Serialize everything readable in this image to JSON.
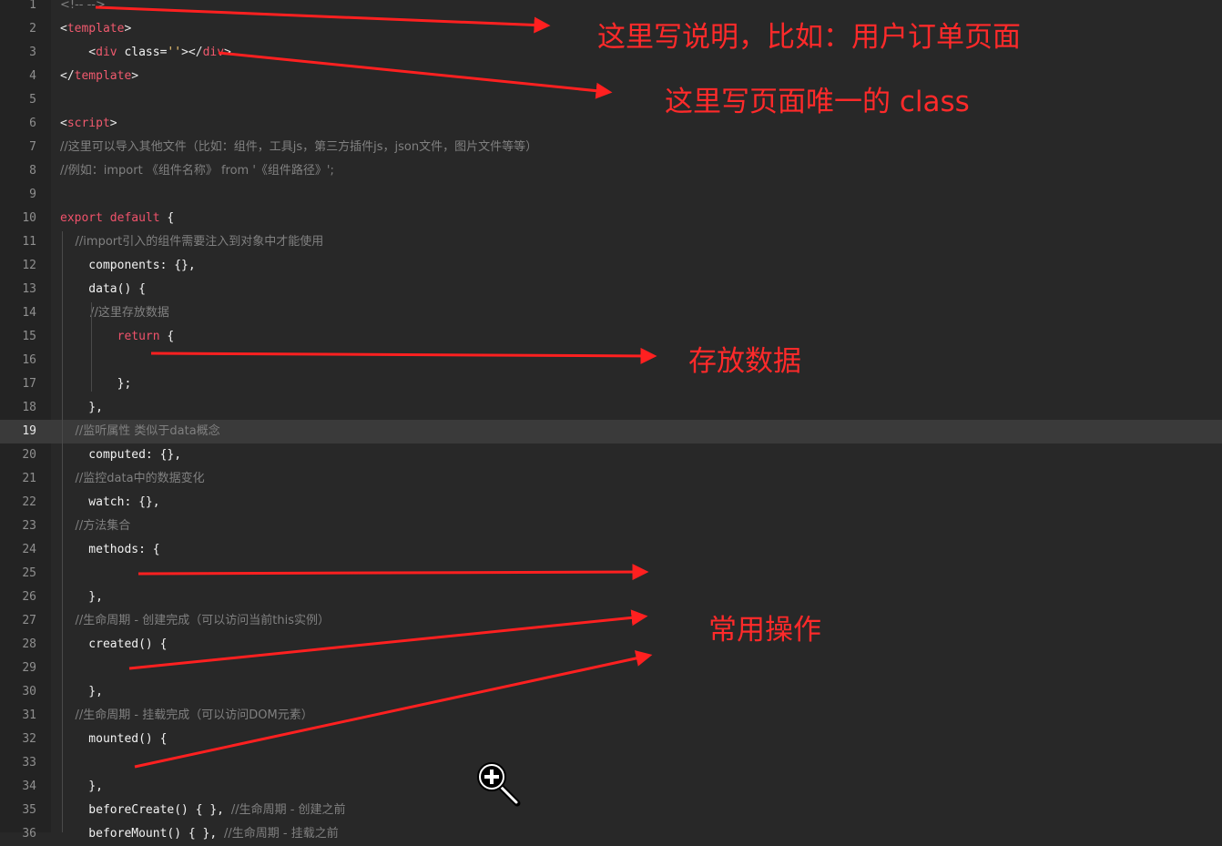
{
  "editor": {
    "lines": [
      {
        "n": "1",
        "parts": [
          {
            "t": "<!-- -->",
            "c": "cmt"
          }
        ]
      },
      {
        "n": "2",
        "parts": [
          {
            "t": "<",
            "c": "tag"
          },
          {
            "t": "template",
            "c": "tagname"
          },
          {
            "t": ">",
            "c": "tag"
          }
        ]
      },
      {
        "n": "3",
        "parts": [
          {
            "t": "    <",
            "c": "tag"
          },
          {
            "t": "div",
            "c": "tagname"
          },
          {
            "t": " class=",
            "c": "prop"
          },
          {
            "t": "''",
            "c": "str"
          },
          {
            "t": "></",
            "c": "tag"
          },
          {
            "t": "div",
            "c": "tagname"
          },
          {
            "t": ">",
            "c": "tag"
          }
        ]
      },
      {
        "n": "4",
        "parts": [
          {
            "t": "</",
            "c": "tag"
          },
          {
            "t": "template",
            "c": "tagname"
          },
          {
            "t": ">",
            "c": "tag"
          }
        ]
      },
      {
        "n": "5",
        "parts": []
      },
      {
        "n": "6",
        "parts": [
          {
            "t": "<",
            "c": "tag"
          },
          {
            "t": "script",
            "c": "tagname"
          },
          {
            "t": ">",
            "c": "tag"
          }
        ]
      },
      {
        "n": "7",
        "parts": [
          {
            "t": "//这里可以导入其他文件（比如：组件，工具js，第三方插件js，json文件，图片文件等等）",
            "c": "cmt"
          }
        ]
      },
      {
        "n": "8",
        "parts": [
          {
            "t": "//例如：import 《组件名称》 from '《组件路径》';",
            "c": "cmt"
          }
        ]
      },
      {
        "n": "9",
        "parts": []
      },
      {
        "n": "10",
        "parts": [
          {
            "t": "export default",
            "c": "kw"
          },
          {
            "t": " {",
            "c": "prop"
          }
        ]
      },
      {
        "n": "11",
        "parts": [
          {
            "t": "    //import引入的组件需要注入到对象中才能使用",
            "c": "cmt"
          }
        ]
      },
      {
        "n": "12",
        "parts": [
          {
            "t": "    components: {},",
            "c": "prop"
          }
        ]
      },
      {
        "n": "13",
        "parts": [
          {
            "t": "    data() {",
            "c": "prop"
          }
        ]
      },
      {
        "n": "14",
        "parts": [
          {
            "t": "        //这里存放数据",
            "c": "cmt"
          }
        ]
      },
      {
        "n": "15",
        "parts": [
          {
            "t": "        ",
            "c": "prop"
          },
          {
            "t": "return",
            "c": "kw"
          },
          {
            "t": " {",
            "c": "prop"
          }
        ]
      },
      {
        "n": "16",
        "parts": []
      },
      {
        "n": "17",
        "parts": [
          {
            "t": "        };",
            "c": "prop"
          }
        ]
      },
      {
        "n": "18",
        "parts": [
          {
            "t": "    },",
            "c": "prop"
          }
        ]
      },
      {
        "n": "19",
        "parts": [
          {
            "t": "    //监听属性 类似于data概念",
            "c": "cmt"
          }
        ],
        "active": true
      },
      {
        "n": "20",
        "parts": [
          {
            "t": "    computed: {},",
            "c": "prop"
          }
        ]
      },
      {
        "n": "21",
        "parts": [
          {
            "t": "    //监控data中的数据变化",
            "c": "cmt"
          }
        ]
      },
      {
        "n": "22",
        "parts": [
          {
            "t": "    watch: {},",
            "c": "prop"
          }
        ]
      },
      {
        "n": "23",
        "parts": [
          {
            "t": "    //方法集合",
            "c": "cmt"
          }
        ]
      },
      {
        "n": "24",
        "parts": [
          {
            "t": "    methods: {",
            "c": "prop"
          }
        ]
      },
      {
        "n": "25",
        "parts": []
      },
      {
        "n": "26",
        "parts": [
          {
            "t": "    },",
            "c": "prop"
          }
        ]
      },
      {
        "n": "27",
        "parts": [
          {
            "t": "    //生命周期 - 创建完成（可以访问当前this实例）",
            "c": "cmt"
          }
        ]
      },
      {
        "n": "28",
        "parts": [
          {
            "t": "    created() {",
            "c": "prop"
          }
        ]
      },
      {
        "n": "29",
        "parts": []
      },
      {
        "n": "30",
        "parts": [
          {
            "t": "    },",
            "c": "prop"
          }
        ]
      },
      {
        "n": "31",
        "parts": [
          {
            "t": "    //生命周期 - 挂载完成（可以访问DOM元素）",
            "c": "cmt"
          }
        ]
      },
      {
        "n": "32",
        "parts": [
          {
            "t": "    mounted() {",
            "c": "prop"
          }
        ]
      },
      {
        "n": "33",
        "parts": []
      },
      {
        "n": "34",
        "parts": [
          {
            "t": "    },",
            "c": "prop"
          }
        ]
      },
      {
        "n": "35",
        "parts": [
          {
            "t": "    beforeCreate() { }, ",
            "c": "prop"
          },
          {
            "t": "//生命周期 - 创建之前",
            "c": "cmt"
          }
        ]
      },
      {
        "n": "36",
        "parts": [
          {
            "t": "    beforeMount() { }, ",
            "c": "prop"
          },
          {
            "t": "//生命周期 - 挂载之前",
            "c": "cmt"
          }
        ]
      }
    ]
  },
  "annotations": {
    "page_description": "这里写说明，比如：用户订单页面",
    "unique_class": "这里写页面唯一的 class",
    "store_data": "存放数据",
    "common_ops": "常用操作"
  },
  "colors": {
    "annotation": "#ff2a2a",
    "background": "#282828",
    "keyword": "#f0526b",
    "comment": "#808080"
  },
  "icons": {
    "zoom": "zoom-in-magnifier-icon"
  }
}
